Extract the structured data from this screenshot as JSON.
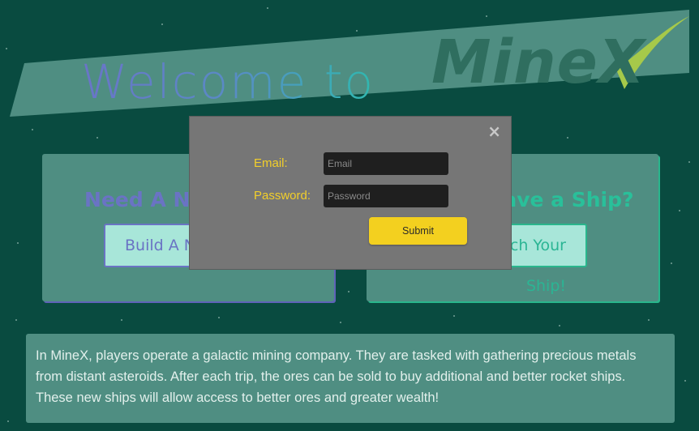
{
  "header": {
    "welcome": "Welcome to",
    "logo": "MineX"
  },
  "cards": {
    "left": {
      "heading": "Need A New Ship?",
      "button": "Build A New Ship"
    },
    "right": {
      "heading": "Already Have a Ship?",
      "button": "Launch Your Ship!"
    }
  },
  "description": "In MineX, players operate a galactic mining company. They are tasked with gathering precious metals from distant asteroids. After each trip, the ores can be sold to buy additional and better rocket ships. These new ships will allow access to better ores and greater wealth!",
  "modal": {
    "close": "×",
    "email_label": "Email:",
    "email_placeholder": "Email",
    "password_label": "Password:",
    "password_placeholder": "Password",
    "submit": "Submit"
  },
  "colors": {
    "background": "#094b40",
    "banner": "#4f8e82",
    "modal": "#767676",
    "accent_yellow": "#f3d01f",
    "label_yellow": "#f2cf2a",
    "purple": "#6a73c4",
    "teal": "#29c09a"
  }
}
